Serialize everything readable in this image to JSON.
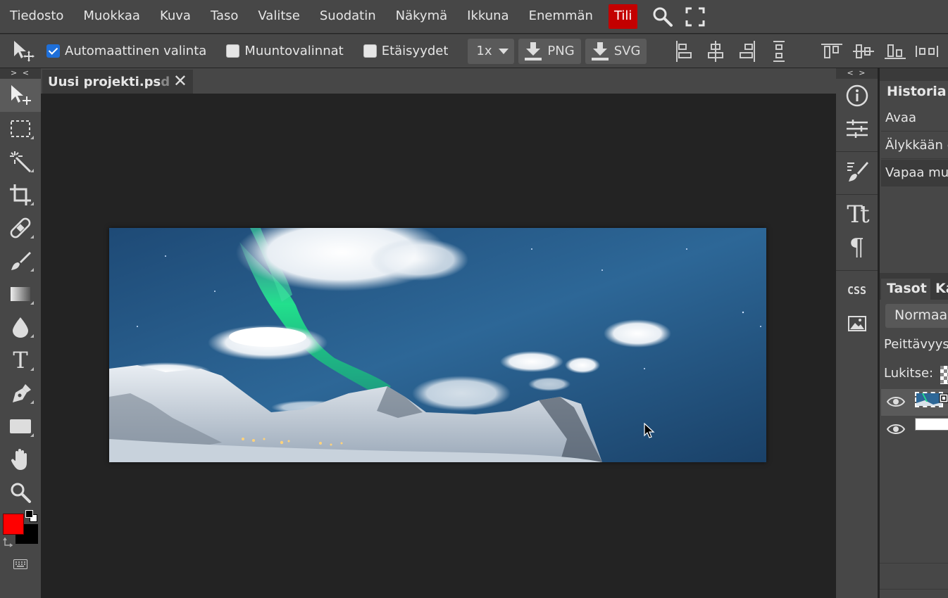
{
  "menu": {
    "items": [
      "Tiedosto",
      "Muokkaa",
      "Kuva",
      "Taso",
      "Valitse",
      "Suodatin",
      "Näkymä",
      "Ikkuna",
      "Enemmän"
    ],
    "account_label": "Tili"
  },
  "options": {
    "auto_select_label": "Automaattinen valinta",
    "auto_select_checked": true,
    "transform_label": "Muuntovalinnat",
    "transform_checked": false,
    "distances_label": "Etäisyydet",
    "distances_checked": false,
    "scale_value": "1x",
    "png_label": "PNG",
    "svg_label": "SVG"
  },
  "toolbar": {
    "collapse_label": "> <",
    "tools": [
      "move-tool",
      "marquee-tool",
      "magic-wand-tool",
      "crop-tool",
      "healing-tool",
      "brush-tool",
      "gradient-tool",
      "blur-tool",
      "text-tool",
      "pen-tool",
      "shape-tool",
      "hand-tool",
      "zoom-tool"
    ],
    "foreground_color": "#ff0000",
    "background_color": "#000000"
  },
  "document": {
    "tab_title": "Uusi projekti.ps",
    "tab_title_faded": "d"
  },
  "iconcol": {
    "collapse_label": "< >"
  },
  "history": {
    "tab_label": "Historia",
    "rows": [
      "Avaa",
      "Älykkään o",
      "Vapaa mu"
    ]
  },
  "layers": {
    "tab_label": "Tasot",
    "tab2_label": "Ka",
    "blend_mode": "Normaa",
    "opacity_label": "Peittävyys",
    "lock_label": "Lukitse:"
  },
  "colors": {
    "accent_red": "#c30000",
    "check_blue": "#1e6fd9"
  }
}
